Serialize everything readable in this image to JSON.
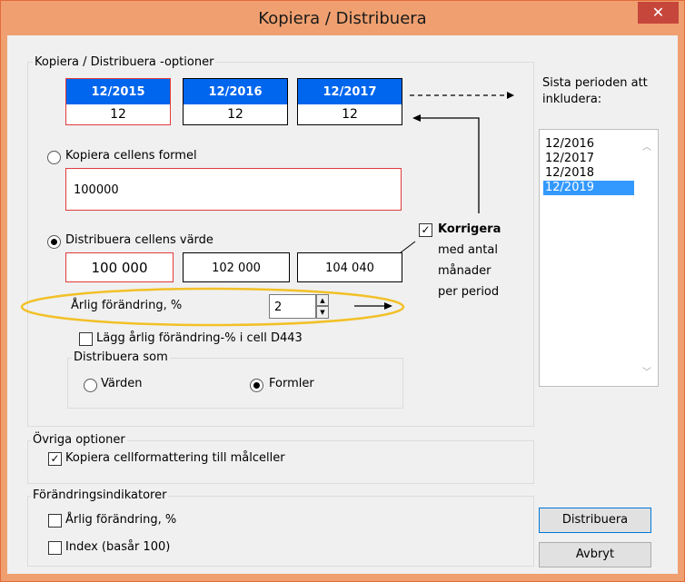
{
  "window": {
    "title": "Kopiera / Distribuera",
    "close_glyph": "✕"
  },
  "options_group": {
    "label": "Kopiera / Distribuera -optioner",
    "periods": [
      {
        "label": "12/2015",
        "value": "12"
      },
      {
        "label": "12/2016",
        "value": "12"
      },
      {
        "label": "12/2017",
        "value": "12"
      }
    ],
    "copy_formula": {
      "label": "Kopiera cellens formel",
      "value": "100000",
      "selected": false
    },
    "distribute_value": {
      "label": "Distribuera cellens värde",
      "selected": true,
      "values": [
        "100 000",
        "102 000",
        "104 040"
      ]
    },
    "annual_change": {
      "label": "Årlig förändring, %",
      "value": "2"
    },
    "add_change_cell": {
      "label": "Lägg årlig förändring-% i cell D443",
      "checked": false
    },
    "distribute_as": {
      "label": "Distribuera som",
      "options": [
        {
          "label": "Värden",
          "selected": false
        },
        {
          "label": "Formler",
          "selected": true
        }
      ]
    },
    "correct": {
      "title": "Korrigera",
      "lines": [
        "med antal",
        "månader",
        "per period"
      ],
      "checked": true
    }
  },
  "last_period": {
    "label_lines": [
      "Sista perioden att",
      "inkludera:"
    ],
    "items": [
      "12/2016",
      "12/2017",
      "12/2018",
      "12/2019"
    ],
    "selected_index": 3
  },
  "other_options": {
    "label": "Övriga optioner",
    "copy_format": {
      "label": "Kopiera cellformattering till målceller",
      "checked": true
    }
  },
  "indicators": {
    "label": "Förändringsindikatorer",
    "items": [
      {
        "label": "Årlig förändring, %",
        "checked": false
      },
      {
        "label": "Index (basår 100)",
        "checked": false
      }
    ]
  },
  "buttons": {
    "distribute": "Distribuera",
    "cancel": "Avbryt"
  },
  "colors": {
    "accent": "#0066ee",
    "highlight": "#e23a3a",
    "annotation": "#f2c027",
    "titlebar": "#f0a070"
  }
}
